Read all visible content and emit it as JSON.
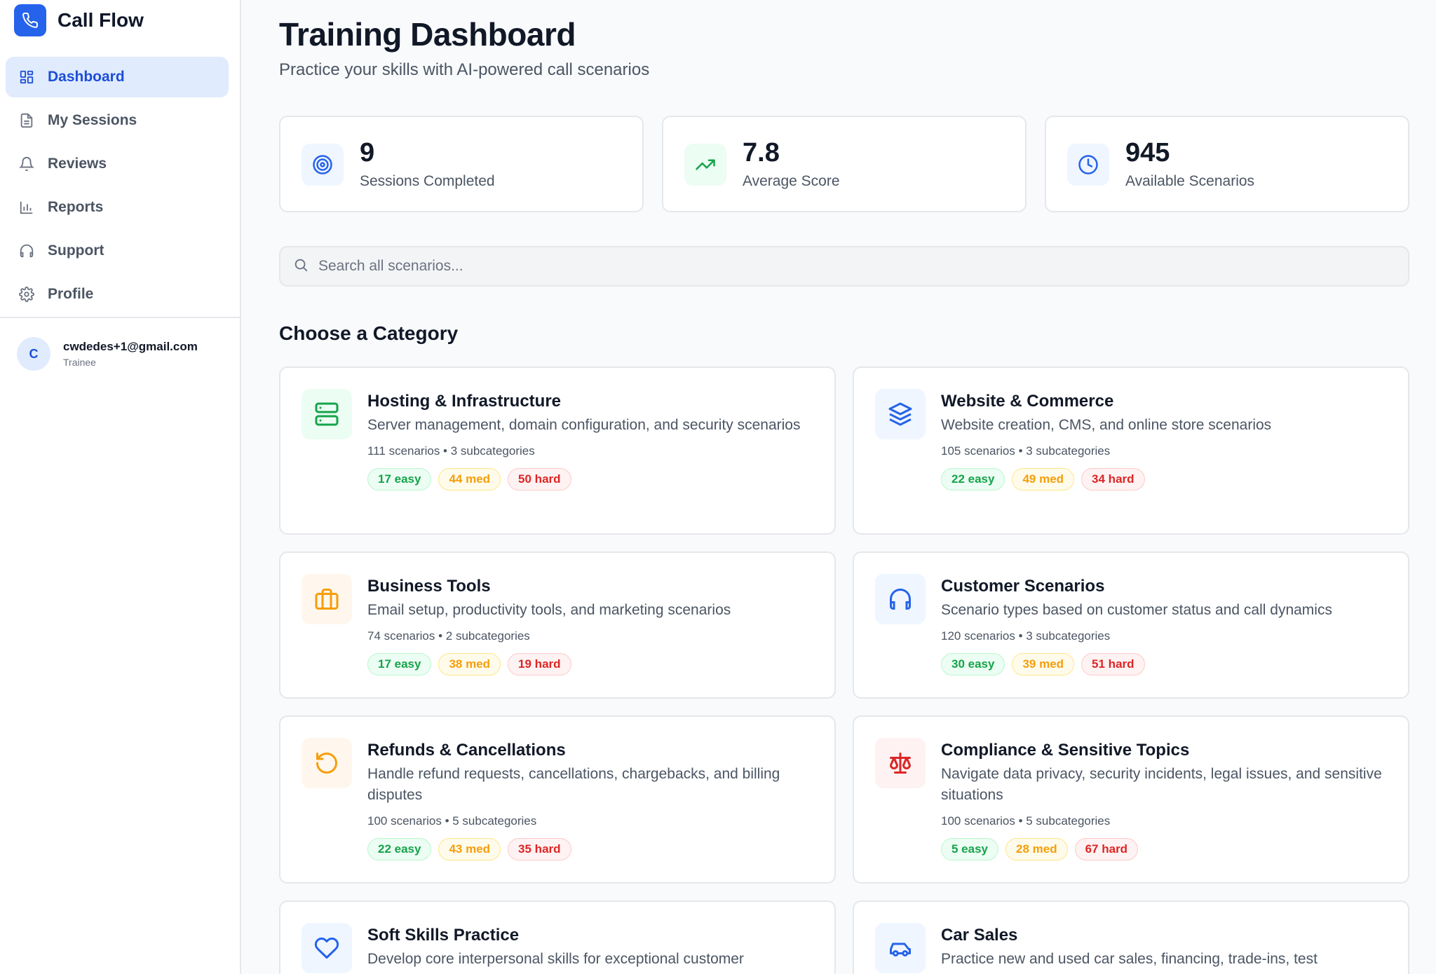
{
  "brand": {
    "name": "Call Flow",
    "icon": "phone-icon",
    "color": "#2563eb"
  },
  "nav": [
    {
      "label": "Dashboard",
      "icon": "grid-icon",
      "active": true
    },
    {
      "label": "My Sessions",
      "icon": "document-icon"
    },
    {
      "label": "Reviews",
      "icon": "bell-icon"
    },
    {
      "label": "Reports",
      "icon": "bar-chart-icon"
    },
    {
      "label": "Support",
      "icon": "headphones-icon"
    },
    {
      "label": "Profile",
      "icon": "gear-icon"
    }
  ],
  "user": {
    "initial": "C",
    "email": "cwdedes+1@gmail.com",
    "role": "Trainee"
  },
  "header": {
    "title": "Training Dashboard",
    "subtitle": "Practice your skills with AI-powered call scenarios"
  },
  "stats": [
    {
      "value": "9",
      "label": "Sessions Completed",
      "icon": "target-icon"
    },
    {
      "value": "7.8",
      "label": "Average Score",
      "icon": "trending-up-icon"
    },
    {
      "value": "945",
      "label": "Available Scenarios",
      "icon": "clock-icon"
    }
  ],
  "search": {
    "placeholder": "Search all scenarios..."
  },
  "section_title": "Choose a Category",
  "categories": [
    {
      "title": "Hosting & Infrastructure",
      "desc": "Server management, domain configuration, and security scenarios",
      "meta": "111 scenarios • 3 subcategories",
      "easy": "17 easy",
      "med": "44 med",
      "hard": "50 hard",
      "icon": "server-icon"
    },
    {
      "title": "Website & Commerce",
      "desc": "Website creation, CMS, and online store scenarios",
      "meta": "105 scenarios • 3 subcategories",
      "easy": "22 easy",
      "med": "49 med",
      "hard": "34 hard",
      "icon": "layers-icon"
    },
    {
      "title": "Business Tools",
      "desc": "Email setup, productivity tools, and marketing scenarios",
      "meta": "74 scenarios • 2 subcategories",
      "easy": "17 easy",
      "med": "38 med",
      "hard": "19 hard",
      "icon": "briefcase-icon"
    },
    {
      "title": "Customer Scenarios",
      "desc": "Scenario types based on customer status and call dynamics",
      "meta": "120 scenarios • 3 subcategories",
      "easy": "30 easy",
      "med": "39 med",
      "hard": "51 hard",
      "icon": "headphones-icon"
    },
    {
      "title": "Refunds & Cancellations",
      "desc": "Handle refund requests, cancellations, chargebacks, and billing disputes",
      "meta": "100 scenarios • 5 subcategories",
      "easy": "22 easy",
      "med": "43 med",
      "hard": "35 hard",
      "icon": "rotate-ccw-icon"
    },
    {
      "title": "Compliance & Sensitive Topics",
      "desc": "Navigate data privacy, security incidents, legal issues, and sensitive situations",
      "meta": "100 scenarios • 5 subcategories",
      "easy": "5 easy",
      "med": "28 med",
      "hard": "67 hard",
      "icon": "scale-icon"
    },
    {
      "title": "Soft Skills Practice",
      "desc": "Develop core interpersonal skills for exceptional customer",
      "icon": "heart-icon"
    },
    {
      "title": "Car Sales",
      "desc": "Practice new and used car sales, financing, trade-ins, test",
      "icon": "car-icon"
    }
  ],
  "colors": {
    "accent": "#2563eb",
    "easy": "#16a34a",
    "med": "#f59e0b",
    "hard": "#dc2626"
  }
}
